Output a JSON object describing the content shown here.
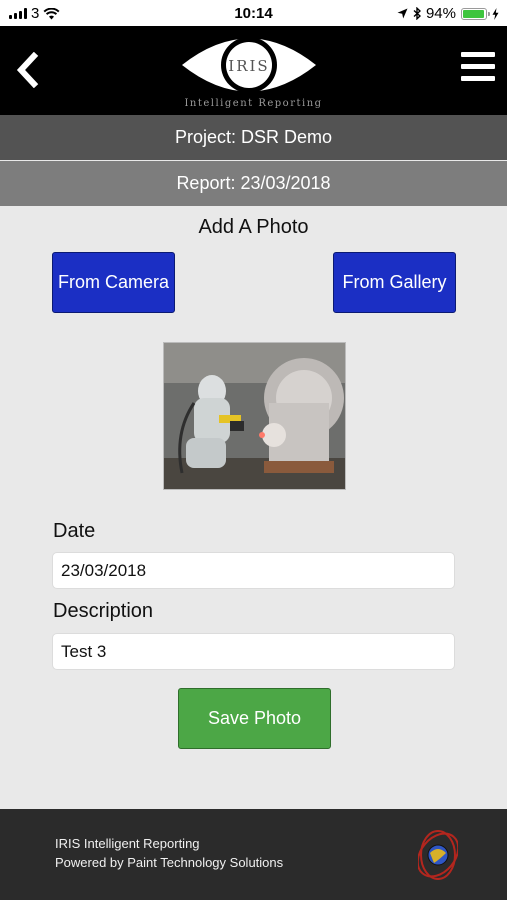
{
  "status_bar": {
    "carrier": "3",
    "time": "10:14",
    "battery_text": "94%",
    "battery_level": 0.94
  },
  "header": {
    "logo_text": "IRIS",
    "tagline": "Intelligent Reporting"
  },
  "project_bar": {
    "text": "Project: DSR Demo"
  },
  "report_bar": {
    "text": "Report: 23/03/2018"
  },
  "photo_section": {
    "title": "Add A Photo",
    "camera_button": "From Camera",
    "gallery_button": "From Gallery"
  },
  "form": {
    "date_label": "Date",
    "date_value": "23/03/2018",
    "description_label": "Description",
    "description_value": "Test 3",
    "save_button": "Save Photo"
  },
  "footer": {
    "line1": "IRIS Intelligent Reporting",
    "line2": "Powered by Paint Technology Solutions"
  },
  "colors": {
    "header_bg": "#000000",
    "project_bar_bg": "#535353",
    "report_bar_bg": "#7d7d7d",
    "source_button_bg": "#1b2fc4",
    "save_button_bg": "#4ca746",
    "footer_bg": "#2b2b2b",
    "battery_green": "#3ec53e"
  },
  "icons": [
    "signal-icon",
    "wifi-icon",
    "location-icon",
    "bluetooth-icon",
    "battery-icon",
    "charging-icon",
    "back-chevron-icon",
    "hamburger-menu-icon"
  ]
}
